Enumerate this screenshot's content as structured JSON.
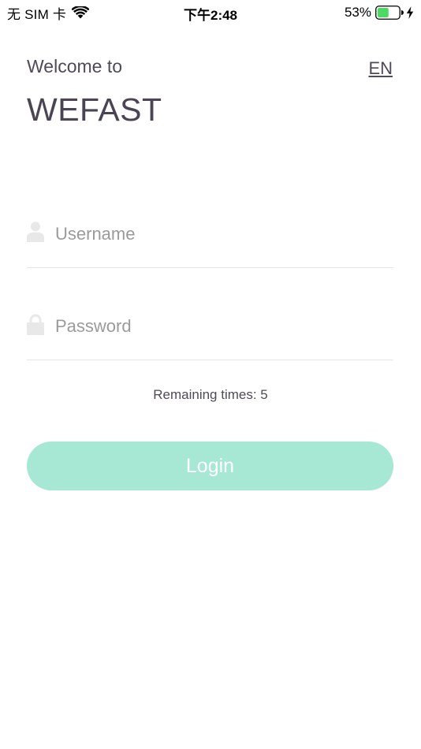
{
  "status_bar": {
    "carrier": "无 SIM 卡",
    "time": "下午2:48",
    "battery_percent": "53%",
    "battery_level": 0.53,
    "battery_color": "#4cd964"
  },
  "header": {
    "welcome": "Welcome to",
    "brand": "WEFAST",
    "language": "EN"
  },
  "form": {
    "username_placeholder": "Username",
    "username_value": "",
    "password_placeholder": "Password",
    "password_value": "",
    "remaining": "Remaining times: 5",
    "login_label": "Login"
  },
  "colors": {
    "accent": "#a7e8d5",
    "text": "#4a4453",
    "placeholder": "#9b9b9b",
    "icon": "#e8e8e8",
    "divider": "#e6e6e6"
  },
  "icons": {
    "wifi": "wifi-icon",
    "battery": "battery-icon",
    "charging": "bolt-icon",
    "username": "user-icon",
    "password": "lock-icon"
  }
}
